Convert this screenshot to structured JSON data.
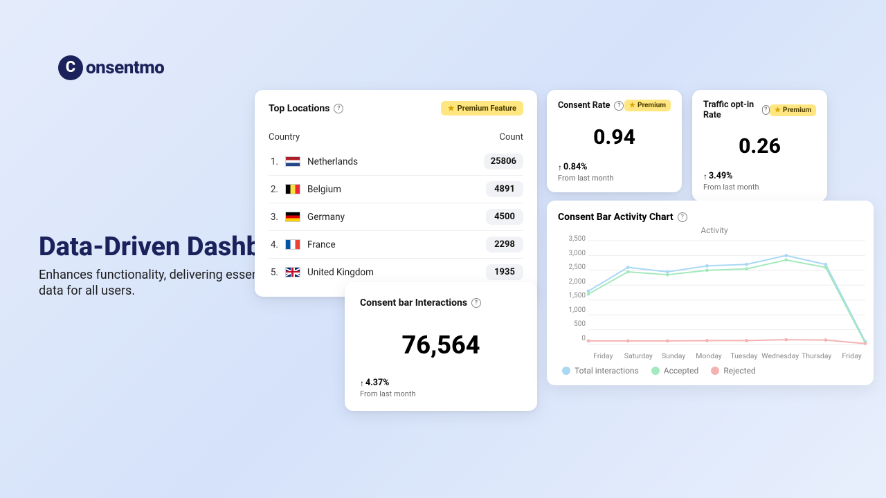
{
  "brand": {
    "name": "onsentmo",
    "mark_letter": "C"
  },
  "hero": {
    "title": "Data-Driven Dashboard",
    "subtitle": "Enhances functionality, delivering essential consent data for all users."
  },
  "premium": {
    "label": "Premium Feature",
    "short": "Premium"
  },
  "top_locations": {
    "title": "Top Locations",
    "col_country": "Country",
    "col_count": "Count",
    "rows": [
      {
        "idx": "1.",
        "name": "Netherlands",
        "flag": "nl",
        "count": "25806"
      },
      {
        "idx": "2.",
        "name": "Belgium",
        "flag": "be",
        "count": "4891"
      },
      {
        "idx": "3.",
        "name": "Germany",
        "flag": "de",
        "count": "4500"
      },
      {
        "idx": "4.",
        "name": "France",
        "flag": "fr",
        "count": "2298"
      },
      {
        "idx": "5.",
        "name": "United Kingdom",
        "flag": "gb",
        "count": "1935"
      }
    ]
  },
  "consent_rate": {
    "title": "Consent Rate",
    "value": "0.94",
    "delta": "0.84%",
    "sub": "From last month"
  },
  "traffic_optin": {
    "title": "Traffic opt-in Rate",
    "value": "0.26",
    "delta": "3.49%",
    "sub": "From last month"
  },
  "interactions": {
    "title": "Consent bar Interactions",
    "value": "76,564",
    "delta": "4.37%",
    "sub": "From last month"
  },
  "activity": {
    "title": "Consent Bar Activity Chart",
    "chart_title": "Activity",
    "legend": {
      "total": "Total interactions",
      "accepted": "Accepted",
      "rejected": "Rejected"
    },
    "colors": {
      "total": "#a9d8f5",
      "accepted": "#a4e9bd",
      "rejected": "#f4b3b3"
    }
  },
  "chart_data": {
    "type": "line",
    "title": "Activity",
    "xlabel": "",
    "ylabel": "",
    "ylim": [
      0,
      3500
    ],
    "y_ticks": [
      "3,500",
      "3,000",
      "2,500",
      "2,000",
      "1,500",
      "1,000",
      "500",
      "0"
    ],
    "categories": [
      "Friday",
      "Saturday",
      "Sunday",
      "Monday",
      "Tuesday",
      "Wednesday",
      "Thursday",
      "Friday"
    ],
    "series": [
      {
        "name": "Total interactions",
        "values": [
          1800,
          2600,
          2450,
          2650,
          2700,
          3000,
          2700,
          100
        ]
      },
      {
        "name": "Accepted",
        "values": [
          1700,
          2450,
          2350,
          2500,
          2550,
          2850,
          2600,
          50
        ]
      },
      {
        "name": "Rejected",
        "values": [
          120,
          120,
          120,
          130,
          130,
          160,
          150,
          30
        ]
      }
    ]
  }
}
